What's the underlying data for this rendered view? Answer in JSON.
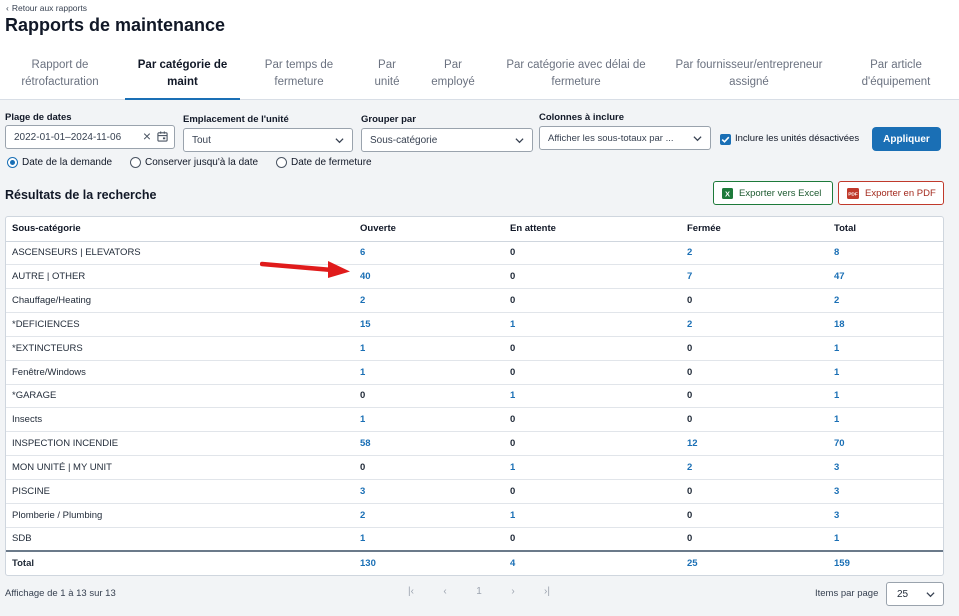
{
  "header": {
    "back_label": "Retour aux rapports",
    "title": "Rapports de maintenance",
    "tabs": [
      {
        "label": "Rapport de rétrofacturation"
      },
      {
        "label": "Par catégorie de maint"
      },
      {
        "label": "Par temps de fermeture"
      },
      {
        "label": "Par unité"
      },
      {
        "label": "Par employé"
      },
      {
        "label": "Par catégorie avec délai de fermeture"
      },
      {
        "label": "Par fournisseur/entrepreneur assigné"
      },
      {
        "label": "Par article d'équipement"
      }
    ]
  },
  "filters": {
    "date_range_label": "Plage de dates",
    "date_range_value": "2022-01-01–2024-11-06",
    "location_label": "Emplacement de l'unité",
    "location_value": "Tout",
    "group_label": "Grouper par",
    "group_value": "Sous-catégorie",
    "columns_label": "Colonnes à inclure",
    "columns_value": "Afficher les sous-totaux par ...",
    "include_disabled_label": "Inclure les unités désactivées",
    "include_disabled_checked": true,
    "apply_label": "Appliquer",
    "date_types": [
      {
        "label": "Date de la demande",
        "checked": true
      },
      {
        "label": "Conserver jusqu'à la date",
        "checked": false
      },
      {
        "label": "Date de fermeture",
        "checked": false
      }
    ]
  },
  "results": {
    "title": "Résultats de la recherche",
    "export_excel_label": "Exporter vers Excel",
    "export_pdf_label": "Exporter en PDF",
    "columns": [
      "Sous-catégorie",
      "Ouverte",
      "En attente",
      "Fermée",
      "Total"
    ],
    "rows": [
      {
        "cat": "ASCENSEURS | ELEVATORS",
        "open": "6",
        "pending": "0",
        "closed": "2",
        "total": "8"
      },
      {
        "cat": "AUTRE | OTHER",
        "open": "40",
        "pending": "0",
        "closed": "7",
        "total": "47"
      },
      {
        "cat": "Chauffage/Heating",
        "open": "2",
        "pending": "0",
        "closed": "0",
        "total": "2"
      },
      {
        "cat": "*DEFICIENCES",
        "open": "15",
        "pending": "1",
        "closed": "2",
        "total": "18"
      },
      {
        "cat": "*EXTINCTEURS",
        "open": "1",
        "pending": "0",
        "closed": "0",
        "total": "1"
      },
      {
        "cat": "Fenêtre/Windows",
        "open": "1",
        "pending": "0",
        "closed": "0",
        "total": "1"
      },
      {
        "cat": "*GARAGE",
        "open": "0",
        "pending": "1",
        "closed": "0",
        "total": "1"
      },
      {
        "cat": "Insects",
        "open": "1",
        "pending": "0",
        "closed": "0",
        "total": "1"
      },
      {
        "cat": "INSPECTION INCENDIE",
        "open": "58",
        "pending": "0",
        "closed": "12",
        "total": "70"
      },
      {
        "cat": "MON UNITÉ | MY UNIT",
        "open": "0",
        "pending": "1",
        "closed": "2",
        "total": "3"
      },
      {
        "cat": "PISCINE",
        "open": "3",
        "pending": "0",
        "closed": "0",
        "total": "3"
      },
      {
        "cat": "Plomberie / Plumbing",
        "open": "2",
        "pending": "1",
        "closed": "0",
        "total": "3"
      },
      {
        "cat": "SDB",
        "open": "1",
        "pending": "0",
        "closed": "0",
        "total": "1"
      }
    ],
    "total": {
      "cat": "Total",
      "open": "130",
      "pending": "4",
      "closed": "25",
      "total": "159"
    }
  },
  "footer": {
    "showing": "Affichage de 1 à 13 sur 13",
    "page": "1",
    "items_per_page_label": "Items par page",
    "items_per_page_value": "25"
  },
  "colors": {
    "accent": "#1a6fb5",
    "arrow": "#e01b1b",
    "excel": "#1d7a3a",
    "pdf": "#c0392b"
  }
}
